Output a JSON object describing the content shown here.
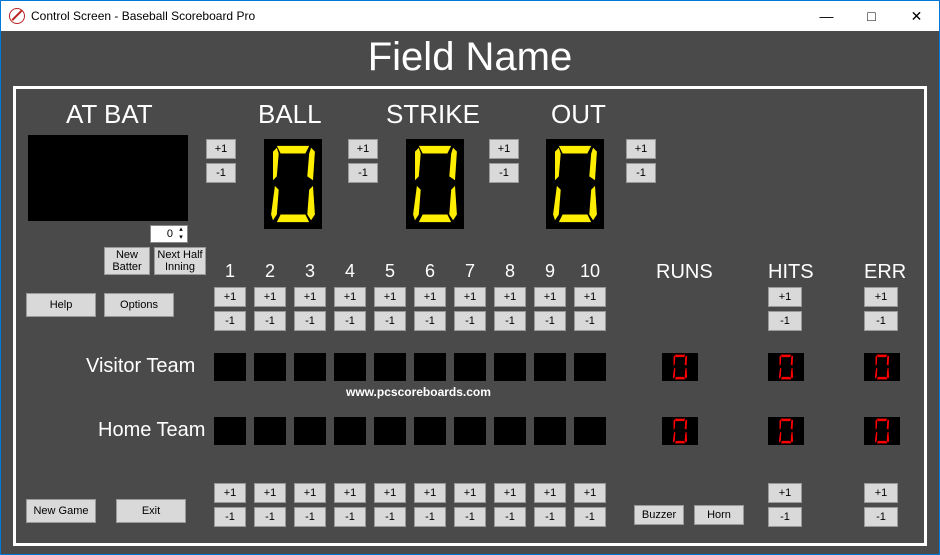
{
  "window": {
    "title": "Control Screen - Baseball Scoreboard Pro"
  },
  "header": {
    "field_name": "Field Name"
  },
  "labels": {
    "at_bat": "AT BAT",
    "ball": "BALL",
    "strike": "STRIKE",
    "out": "OUT",
    "runs": "RUNS",
    "hits": "HITS",
    "err": "ERR",
    "visitor": "Visitor Team",
    "home": "Home Team",
    "plus": "+1",
    "minus": "-1"
  },
  "counts": {
    "ball": "0",
    "strike": "0",
    "out": "0",
    "atbat_spinner": "0"
  },
  "buttons": {
    "new_batter": "New Batter",
    "next_half": "Next Half Inning",
    "help": "Help",
    "options": "Options",
    "new_game": "New Game",
    "exit": "Exit",
    "buzzer": "Buzzer",
    "horn": "Horn"
  },
  "innings": [
    "1",
    "2",
    "3",
    "4",
    "5",
    "6",
    "7",
    "8",
    "9",
    "10"
  ],
  "visitor": {
    "runs": "0",
    "hits": "0",
    "err": "0",
    "innings": [
      "",
      "",
      "",
      "",
      "",
      "",
      "",
      "",
      "",
      ""
    ]
  },
  "home": {
    "runs": "0",
    "hits": "0",
    "err": "0",
    "innings": [
      "",
      "",
      "",
      "",
      "",
      "",
      "",
      "",
      "",
      ""
    ]
  },
  "watermark": "www.pcscoreboards.com"
}
